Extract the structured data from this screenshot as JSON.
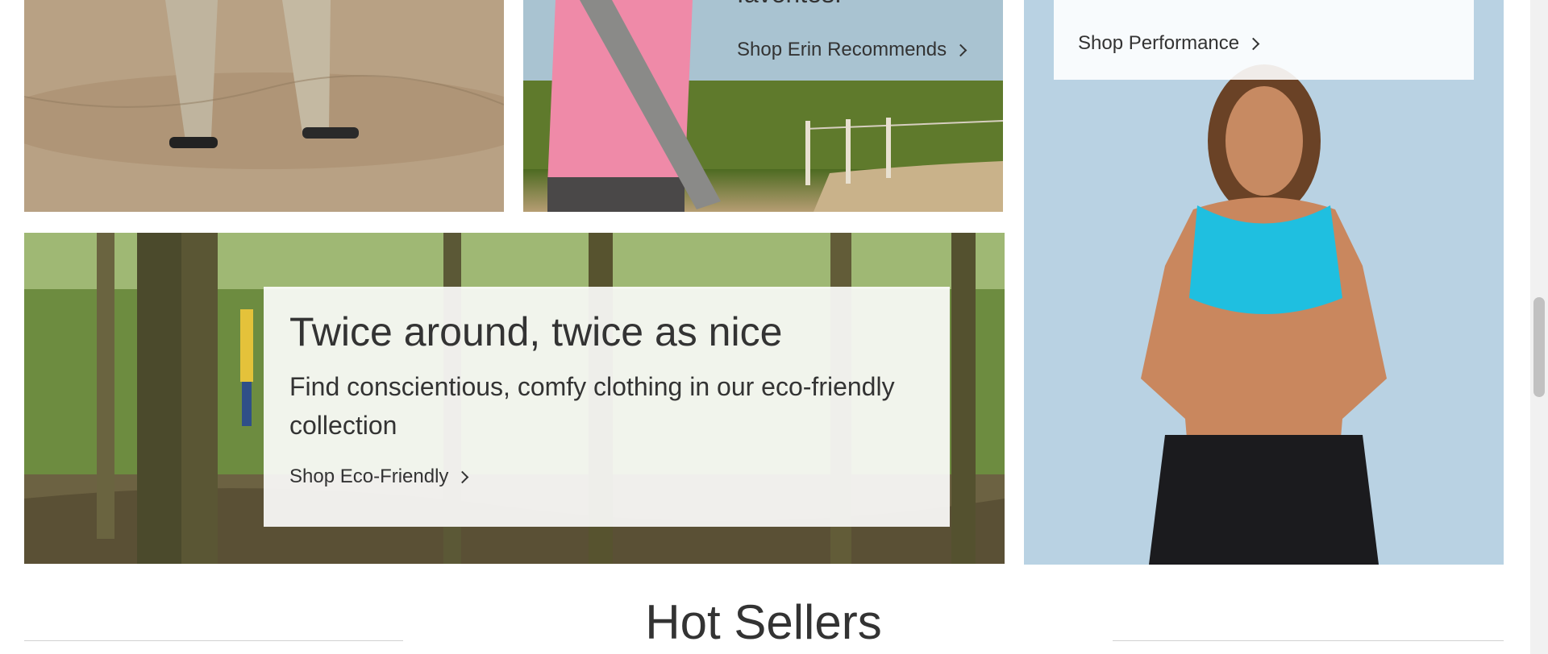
{
  "blocks": {
    "pants": {
      "image_desc_icon": "pants-sandals-photo"
    },
    "yoga": {
      "partial_info": "favorites!",
      "link_label": "Shop Erin Recommends"
    },
    "eco": {
      "title": "Twice around, twice as nice",
      "info": "Find conscientious, comfy clothing in our eco-friendly collection",
      "link_label": "Shop Eco-Friendly"
    },
    "performance": {
      "link_label": "Shop Performance"
    }
  },
  "hot_sellers": {
    "title": "Hot Sellers"
  },
  "colors": {
    "text": "#333333",
    "overlay": "#ffffff",
    "rule": "#d1d1d1"
  }
}
